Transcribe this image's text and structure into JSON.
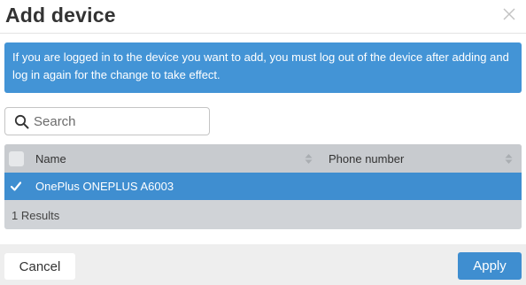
{
  "dialog": {
    "title": "Add device",
    "close_icon": "close-icon"
  },
  "info": {
    "message": "If you are logged in to the device you want to add, you must log out of the device after adding and log in again for the change to take effect."
  },
  "search": {
    "placeholder": "Search",
    "value": "",
    "icon": "search-icon"
  },
  "table": {
    "columns": [
      {
        "label": "Name",
        "sortable": true
      },
      {
        "label": "Phone number",
        "sortable": true
      }
    ],
    "rows": [
      {
        "name": "OnePlus ONEPLUS A6003",
        "phone": "",
        "selected": true
      }
    ],
    "results_text": "1 Results"
  },
  "actions": {
    "cancel_label": "Cancel",
    "apply_label": "Apply"
  },
  "colors": {
    "accent": "#3f8ed0",
    "info_banner": "#4394d6",
    "table_bg": "#d0d3d7",
    "footer_bg": "#eeeeee"
  }
}
